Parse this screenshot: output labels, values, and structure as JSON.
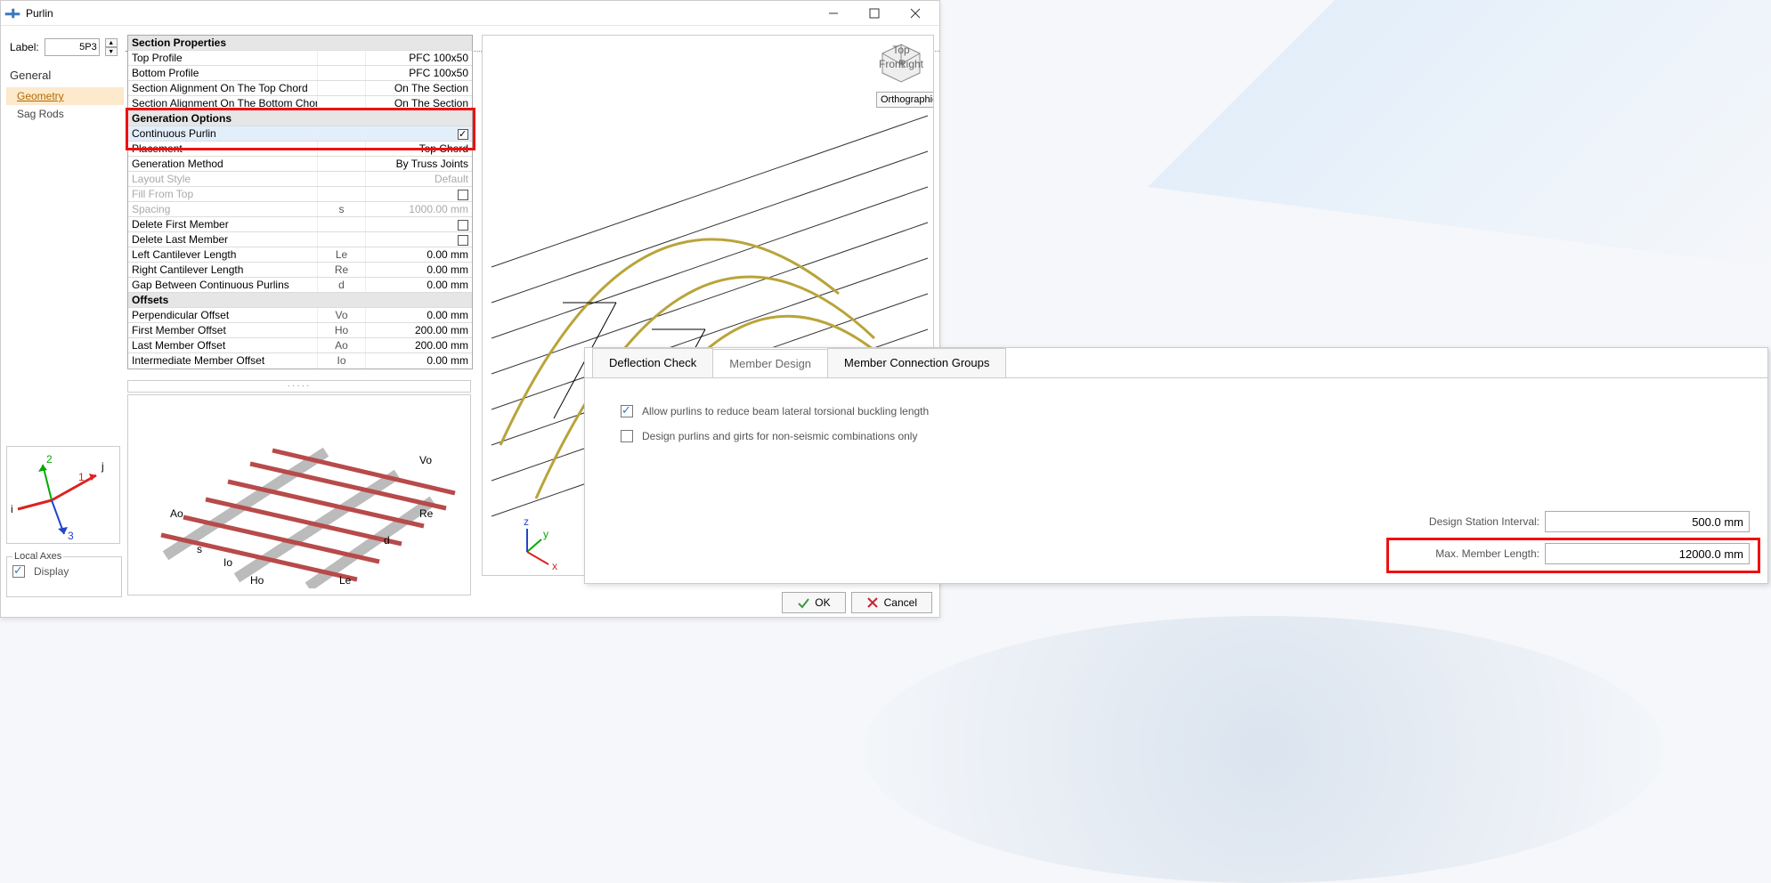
{
  "window": {
    "title": "Purlin"
  },
  "label_field": {
    "caption": "Label:",
    "value": "5P3"
  },
  "nav": {
    "group": "General",
    "items": [
      "Geometry",
      "Sag Rods"
    ],
    "active": 0
  },
  "propgrid": {
    "sections": [
      {
        "header": "Section Properties",
        "rows": [
          {
            "name": "Top Profile",
            "sym": "",
            "val": "PFC 100x50",
            "dim": true
          },
          {
            "name": "Bottom Profile",
            "sym": "",
            "val": "PFC 100x50"
          },
          {
            "name": "Section Alignment On The Top Chord",
            "sym": "",
            "val": "On The Section"
          },
          {
            "name": "Section Alignment On The Bottom Chord",
            "sym": "",
            "val": "On The Section"
          }
        ]
      },
      {
        "header": "Generation Options",
        "rows": [
          {
            "name": "Continuous Purlin",
            "sym": "",
            "val": "",
            "check": true,
            "checked": true,
            "selected": true
          },
          {
            "name": "Placement",
            "sym": "",
            "val": "Top Chord"
          },
          {
            "name": "Generation Method",
            "sym": "",
            "val": "By Truss Joints"
          },
          {
            "name": "Layout Style",
            "sym": "",
            "val": "Default",
            "disabled": true
          },
          {
            "name": "Fill From Top",
            "sym": "",
            "val": "",
            "check": true,
            "checked": false,
            "disabled": true
          },
          {
            "name": "Spacing",
            "sym": "s",
            "val": "1000.00 mm",
            "disabled": true
          },
          {
            "name": "Delete First Member",
            "sym": "",
            "val": "",
            "check": true,
            "checked": false
          },
          {
            "name": "Delete Last Member",
            "sym": "",
            "val": "",
            "check": true,
            "checked": false
          },
          {
            "name": "Left Cantilever Length",
            "sym": "Le",
            "val": "0.00 mm"
          },
          {
            "name": "Right Cantilever Length",
            "sym": "Re",
            "val": "0.00 mm"
          },
          {
            "name": "Gap Between Continuous Purlins",
            "sym": "d",
            "val": "0.00 mm"
          }
        ]
      },
      {
        "header": "Offsets",
        "rows": [
          {
            "name": "Perpendicular Offset",
            "sym": "Vo",
            "val": "0.00 mm"
          },
          {
            "name": "First Member Offset",
            "sym": "Ho",
            "val": "200.00 mm"
          },
          {
            "name": "Last Member Offset",
            "sym": "Ao",
            "val": "200.00 mm"
          },
          {
            "name": "Intermediate Member Offset",
            "sym": "Io",
            "val": "0.00 mm"
          }
        ]
      }
    ]
  },
  "preview_labels": {
    "Ao": "Ao",
    "Ho": "Ho",
    "Le": "Le",
    "Re": "Re",
    "Vo": "Vo",
    "s": "s",
    "Io": "Io",
    "d": "d"
  },
  "local_axes": {
    "legend": "Local Axes",
    "display": "Display",
    "checked": true,
    "i": "i",
    "j": "j",
    "n1": "1",
    "n2": "2",
    "n3": "3"
  },
  "viewport": {
    "ortho": "Orthographic",
    "cube": {
      "top": "Top",
      "right": "Right",
      "front": "Front"
    },
    "axis": {
      "x": "x",
      "y": "y",
      "z": "z"
    }
  },
  "footer": {
    "ok": "OK",
    "cancel": "Cancel"
  },
  "floatpanel": {
    "tabs": [
      "Deflection Check",
      "Member Design",
      "Member Connection Groups"
    ],
    "active": 1,
    "chk1": {
      "label": "Allow purlins to reduce beam lateral torsional buckling length",
      "checked": true
    },
    "chk2": {
      "label": "Design purlins and girts for non-seismic combinations only",
      "checked": false
    },
    "field1": {
      "label": "Design Station Interval:",
      "value": "500.0 mm"
    },
    "field2": {
      "label": "Max. Member Length:",
      "value": "12000.0 mm"
    }
  }
}
